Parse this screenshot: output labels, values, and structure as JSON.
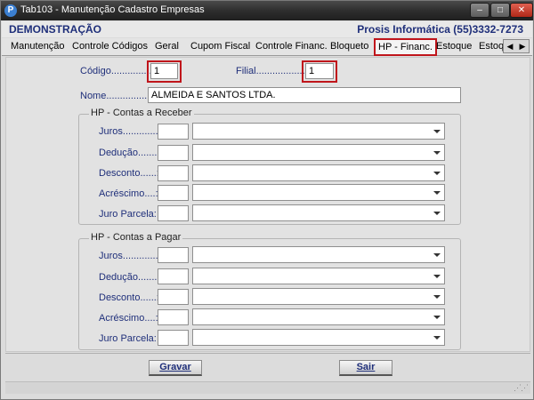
{
  "window": {
    "title": "Tab103 - Manutenção Cadastro Empresas",
    "app_icon_letter": "P",
    "controls": {
      "minimize": "–",
      "maximize": "□",
      "close": "✕"
    }
  },
  "header": {
    "left": "DEMONSTRAÇÃO",
    "right": "Prosis Informática (55)3332-7273"
  },
  "tabs": [
    {
      "label": "Manutenção"
    },
    {
      "label": "Controle Códigos"
    },
    {
      "label": "Geral"
    },
    {
      "label": "Cupom Fiscal"
    },
    {
      "label": "Controle Financ."
    },
    {
      "label": "Bloqueto"
    },
    {
      "label": "HP - Financ.",
      "active": true
    },
    {
      "label": "Estoque"
    },
    {
      "label": "Estoq"
    }
  ],
  "tab_scroll": {
    "left": "◀",
    "right": "▶"
  },
  "form": {
    "codigo_label": "Código...............:",
    "codigo_value": "1",
    "filial_label": "Filial...................:",
    "filial_value": "1",
    "nome_label": "Nome...............:",
    "nome_value": "ALMEIDA E SANTOS LTDA."
  },
  "receber": {
    "title": "HP - Contas a Receber",
    "rows": [
      {
        "label": "Juros..............:"
      },
      {
        "label": "Dedução.......:"
      },
      {
        "label": "Desconto......:"
      },
      {
        "label": "Acréscimo....:"
      },
      {
        "label": "Juro Parcela:"
      }
    ]
  },
  "pagar": {
    "title": "HP - Contas a Pagar",
    "rows": [
      {
        "label": "Juros..............:"
      },
      {
        "label": "Dedução.......:"
      },
      {
        "label": "Desconto......:"
      },
      {
        "label": "Acréscimo....:"
      },
      {
        "label": "Juro Parcela:"
      }
    ]
  },
  "buttons": {
    "gravar": "Gravar",
    "sair": "Sair"
  },
  "colors": {
    "accent_blue": "#1f2f7a",
    "highlight_red": "#c0151b"
  }
}
